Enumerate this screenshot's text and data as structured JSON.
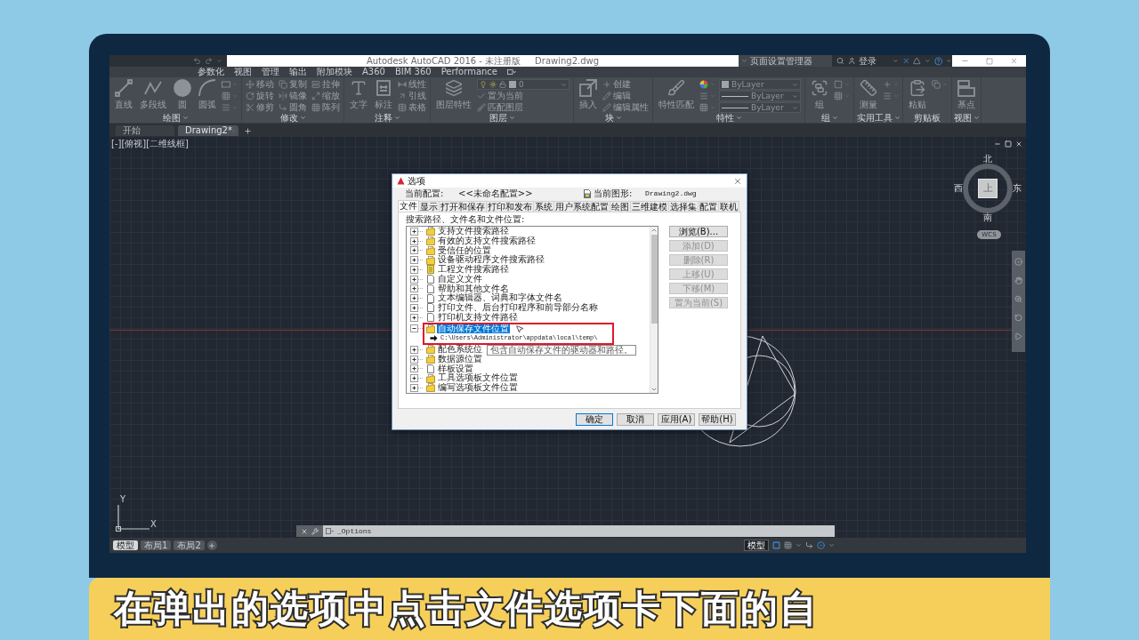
{
  "title_bar": {
    "title": "Autodesk AutoCAD 2016 - 未注册版",
    "document": "Drawing2.dwg",
    "search": {
      "value": "页面设置管理器"
    },
    "sign_in": "登录"
  },
  "ribbon": {
    "tabs": [
      "参数化",
      "视图",
      "管理",
      "输出",
      "附加模块",
      "A360",
      "BIM 360",
      "Performance"
    ],
    "panels": [
      {
        "kind": "draw",
        "title": "绘图",
        "has_menu": true,
        "big_tools": [
          "直线",
          "多段线",
          "圆",
          "圆弧"
        ]
      },
      {
        "kind": "modify",
        "title": "修改",
        "has_menu": true,
        "small_tools": [
          "移动",
          "旋转",
          "修剪",
          "复制",
          "镜像",
          "圆角",
          "拉伸",
          "缩放",
          "阵列"
        ]
      },
      {
        "kind": "annotate",
        "title": "注释",
        "has_menu": true,
        "big_tools": [
          "文字",
          "标注"
        ],
        "small_tools": [
          "线性",
          "引线",
          "表格"
        ]
      },
      {
        "kind": "layers",
        "title": "图层",
        "has_menu": true,
        "big_tools": [
          "图层特性"
        ],
        "dropdowns": [
          "0"
        ],
        "small_tools": [
          "置为当前",
          "匹配图层"
        ]
      },
      {
        "kind": "block",
        "title": "块",
        "has_menu": true,
        "big_tools": [
          "插入"
        ],
        "small_tools": [
          "创建",
          "编辑",
          "编辑属性"
        ]
      },
      {
        "kind": "properties",
        "title": "特性",
        "has_menu": true,
        "big_tools": [
          "特性匹配"
        ],
        "dropdowns": [
          "ByLayer",
          "ByLayer",
          "ByLayer"
        ]
      },
      {
        "kind": "groups",
        "title": "组",
        "has_menu": true,
        "big_tools": [
          "组"
        ]
      },
      {
        "kind": "utilities",
        "title": "实用工具",
        "has_menu": true,
        "big_tools": [
          "测量"
        ]
      },
      {
        "kind": "clipboard",
        "title": "剪贴板",
        "has_menu": false,
        "big_tools": [
          "粘贴"
        ]
      },
      {
        "kind": "view",
        "title": "视图",
        "has_menu": true,
        "big_tools": [
          "基点"
        ]
      }
    ]
  },
  "document_tabs": [
    {
      "label": "开始",
      "selected": false
    },
    {
      "label": "Drawing2*",
      "selected": true
    }
  ],
  "viewport": {
    "label": "[-][俯视][二维线框]",
    "viewcube": {
      "face": "上",
      "north": "北",
      "south": "南",
      "west": "西",
      "east": "东"
    },
    "coordinate_system": "WCS",
    "ucs_icon": {
      "y_label": "Y",
      "x_label": "X"
    }
  },
  "options_dialog": {
    "title": "选项",
    "current_profile_label": "当前配置:",
    "current_profile": "<<未命名配置>>",
    "current_drawing_label": "当前图形:",
    "current_drawing": "Drawing2.dwg",
    "tabs": [
      {
        "label": "文件",
        "selected": true
      },
      {
        "label": "显示",
        "selected": false
      },
      {
        "label": "打开和保存",
        "selected": false
      },
      {
        "label": "打印和发布",
        "selected": false
      },
      {
        "label": "系统",
        "selected": false
      },
      {
        "label": "用户系统配置",
        "selected": false
      },
      {
        "label": "绘图",
        "selected": false
      },
      {
        "label": "三维建模",
        "selected": false
      },
      {
        "label": "选择集",
        "selected": false
      },
      {
        "label": "配置",
        "selected": false
      },
      {
        "label": "联机",
        "selected": false
      }
    ],
    "tree_label": "搜索路径、文件名和文件位置:",
    "tree": [
      {
        "kind": "folder",
        "label": "支持文件搜索路径",
        "expanded": false,
        "selected": false,
        "highlighted": false
      },
      {
        "kind": "folder",
        "label": "有效的支持文件搜索路径",
        "expanded": false,
        "selected": false,
        "highlighted": false
      },
      {
        "kind": "folder",
        "label": "受信任的位置",
        "expanded": false,
        "selected": false,
        "highlighted": false
      },
      {
        "kind": "folder",
        "label": "设备驱动程序文件搜索路径",
        "expanded": false,
        "selected": false,
        "highlighted": false
      },
      {
        "kind": "project",
        "label": "工程文件搜索路径",
        "expanded": false,
        "selected": false,
        "highlighted": false
      },
      {
        "kind": "file",
        "label": "自定义文件",
        "expanded": false,
        "selected": false,
        "highlighted": false
      },
      {
        "kind": "file",
        "label": "帮助和其他文件名",
        "expanded": false,
        "selected": false,
        "highlighted": false
      },
      {
        "kind": "file",
        "label": "文本编辑器、词典和字体文件名",
        "expanded": false,
        "selected": false,
        "highlighted": false
      },
      {
        "kind": "file",
        "label": "打印文件、后台打印程序和前导部分名称",
        "expanded": false,
        "selected": false,
        "highlighted": false
      },
      {
        "kind": "file",
        "label": "打印机支持文件路径",
        "expanded": false,
        "selected": false,
        "highlighted": false
      },
      {
        "kind": "folder",
        "label": "自动保存文件位置",
        "expanded": true,
        "selected": true,
        "highlighted": true,
        "tooltip": "包含自动保存文件的驱动器和路径。",
        "children": [
          {
            "kind": "path",
            "label": "C:\\Users\\Administrator\\appdata\\local\\temp\\",
            "selected": false
          }
        ]
      },
      {
        "kind": "folder",
        "label": "配色系统位",
        "expanded": false,
        "selected": false,
        "highlighted": false
      },
      {
        "kind": "folder",
        "label": "数据源位置",
        "expanded": false,
        "selected": false,
        "highlighted": false
      },
      {
        "kind": "file",
        "label": "样板设置",
        "expanded": false,
        "selected": false,
        "highlighted": false
      },
      {
        "kind": "folder",
        "label": "工具选项板文件位置",
        "expanded": false,
        "selected": false,
        "highlighted": false
      },
      {
        "kind": "folder",
        "label": "编写选项板文件位置",
        "expanded": false,
        "selected": false,
        "highlighted": false
      }
    ],
    "side_buttons": [
      {
        "label": "浏览(B)...",
        "disabled": false
      },
      {
        "label": "添加(D)",
        "disabled": true
      },
      {
        "label": "删除(R)",
        "disabled": true
      },
      {
        "label": "上移(U)",
        "disabled": true
      },
      {
        "label": "下移(M)",
        "disabled": true
      },
      {
        "label": "置为当前(S)",
        "disabled": true
      }
    ],
    "buttons": [
      {
        "label": "确定",
        "default": true
      },
      {
        "label": "取消",
        "default": false
      },
      {
        "label": "应用(A)",
        "default": false
      },
      {
        "label": "帮助(H)",
        "default": false
      }
    ]
  },
  "command_line": {
    "value": "_Options"
  },
  "layout_tabs": [
    {
      "label": "模型",
      "selected": true
    },
    {
      "label": "布局1",
      "selected": false
    },
    {
      "label": "布局2",
      "selected": false
    }
  ],
  "status_bar": {
    "space": "模型"
  },
  "subtitle": "在弹出的选项中点击文件选项卡下面的自"
}
